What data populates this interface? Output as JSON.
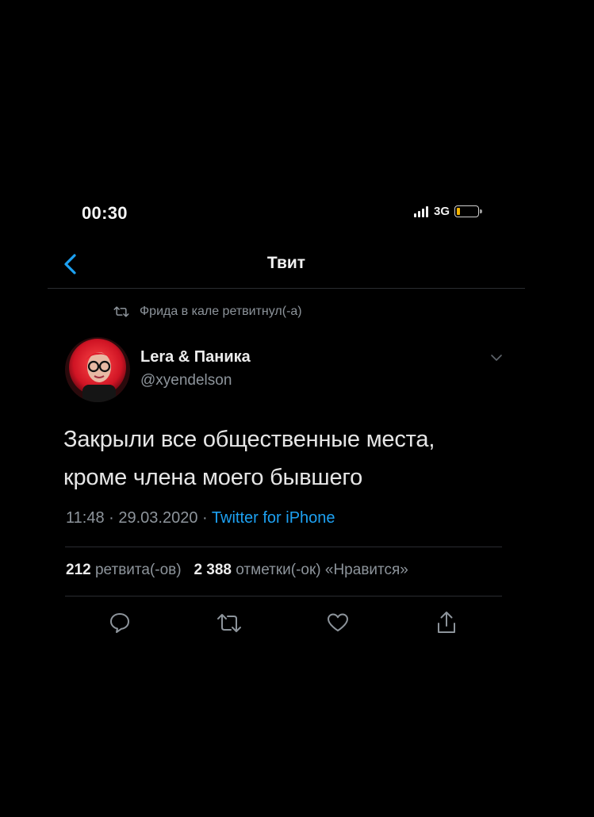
{
  "status_bar": {
    "time": "00:30",
    "network": "3G",
    "signal_bars": 4,
    "battery_level": 0.15,
    "battery_color": "#f3b300"
  },
  "nav": {
    "title": "Твит",
    "back_icon": "chevron-left-icon",
    "accent_color": "#1da1f2"
  },
  "retweet_notice": {
    "icon": "retweet-icon",
    "text": "Фрида в кале ретвитнул(-а)"
  },
  "tweet": {
    "author_name": "Lera & Паника",
    "author_handle": "@xyendelson",
    "text_line1": "Закрыли все общественные места,",
    "text_line2": "кроме члена моего бывшего",
    "time": "11:48",
    "date": "29.03.2020",
    "separator": "·",
    "source": "Twitter for iPhone"
  },
  "stats": {
    "retweets_count": "212",
    "retweets_label": "ретвита(-ов)",
    "likes_count": "2 388",
    "likes_label": "отметки(-ок) «Нравится»"
  },
  "actions": [
    "reply-icon",
    "retweet-icon",
    "like-icon",
    "share-icon"
  ]
}
